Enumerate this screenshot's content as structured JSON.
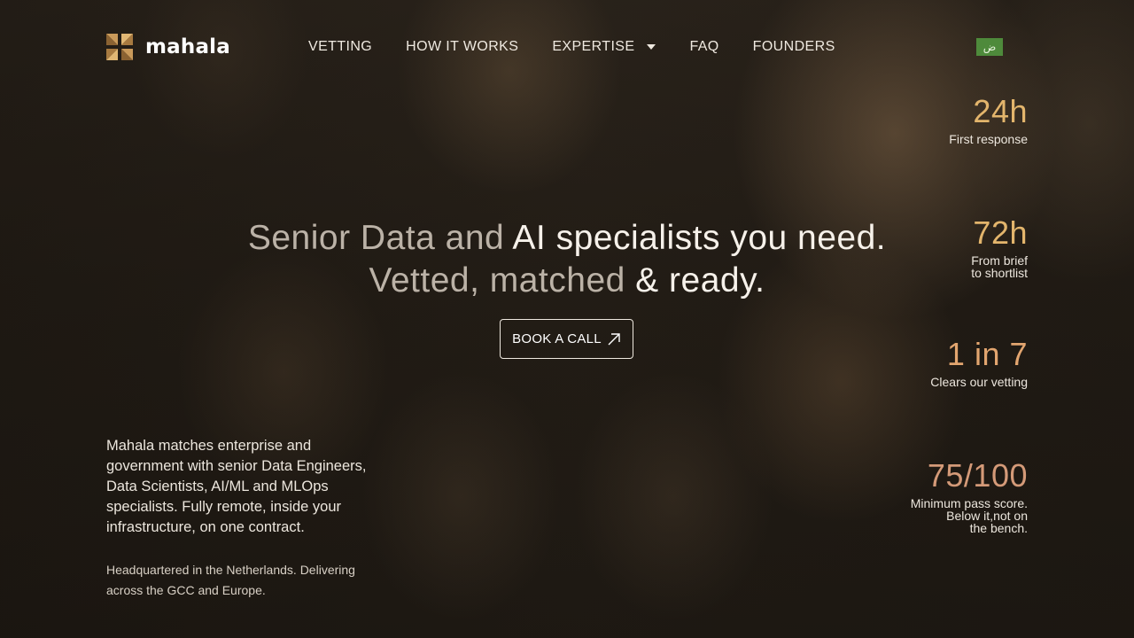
{
  "brand": {
    "name": "mahala",
    "colors": {
      "accent": "#e3b56c",
      "language_badge": "#4e8a3b"
    }
  },
  "nav": {
    "items": [
      {
        "label": "VETTING"
      },
      {
        "label": "HOW IT WORKS"
      },
      {
        "label": "EXPERTISE",
        "has_dropdown": true
      },
      {
        "label": "FAQ"
      },
      {
        "label": "FOUNDERS"
      }
    ],
    "language_toggle": "ض"
  },
  "hero": {
    "headline_line1_a": "Senior Data and",
    "headline_line1_b": " AI specialists you need.",
    "headline_line2_a": "Vetted, matched",
    "headline_line2_b": " & ready.",
    "cta_label": "BOOK A CALL",
    "cta_icon": "arrow-up-right-icon"
  },
  "intro": {
    "text": "Mahala matches enterprise and government with senior Data Engineers, Data Scientists, AI/ML and MLOps specialists. Fully remote, inside your infrastructure, on one contract.",
    "hq": "Headquartered in the Netherlands. Delivering across the GCC and Europe."
  },
  "stats": [
    {
      "value": "24h",
      "label": "First response"
    },
    {
      "value": "72h",
      "label": "From brief\nto shortlist"
    },
    {
      "value": "1 in 7",
      "label": "Clears our vetting"
    },
    {
      "value": "75/100",
      "label": "Minimum pass score.\nBelow it,not on\nthe bench."
    }
  ]
}
